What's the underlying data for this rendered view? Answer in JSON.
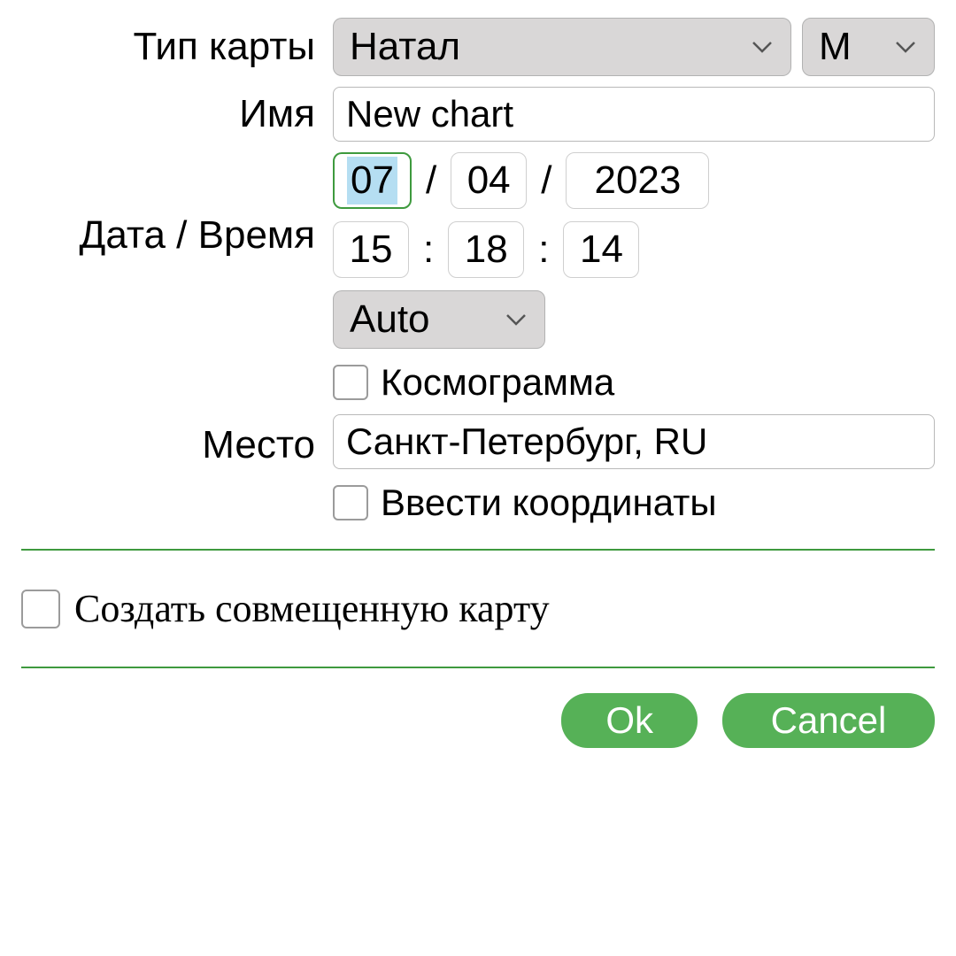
{
  "labels": {
    "chart_type": "Тип карты",
    "name": "Имя",
    "date_time": "Дата / Время",
    "place": "Место"
  },
  "chart_type": {
    "selected": "Натал",
    "gender": "М"
  },
  "name": {
    "value": "New chart"
  },
  "date": {
    "day": "07",
    "month": "04",
    "year": "2023",
    "sep": "/"
  },
  "time": {
    "hour": "15",
    "minute": "18",
    "second": "14",
    "sep": ":"
  },
  "timezone": {
    "mode": "Auto"
  },
  "checkboxes": {
    "cosmogram": "Космограмма",
    "enter_coords": "Ввести координаты",
    "combined_chart": "Создать совмещенную карту"
  },
  "place": {
    "value": "Санкт-Петербург, RU"
  },
  "buttons": {
    "ok": "Ok",
    "cancel": "Cancel"
  }
}
